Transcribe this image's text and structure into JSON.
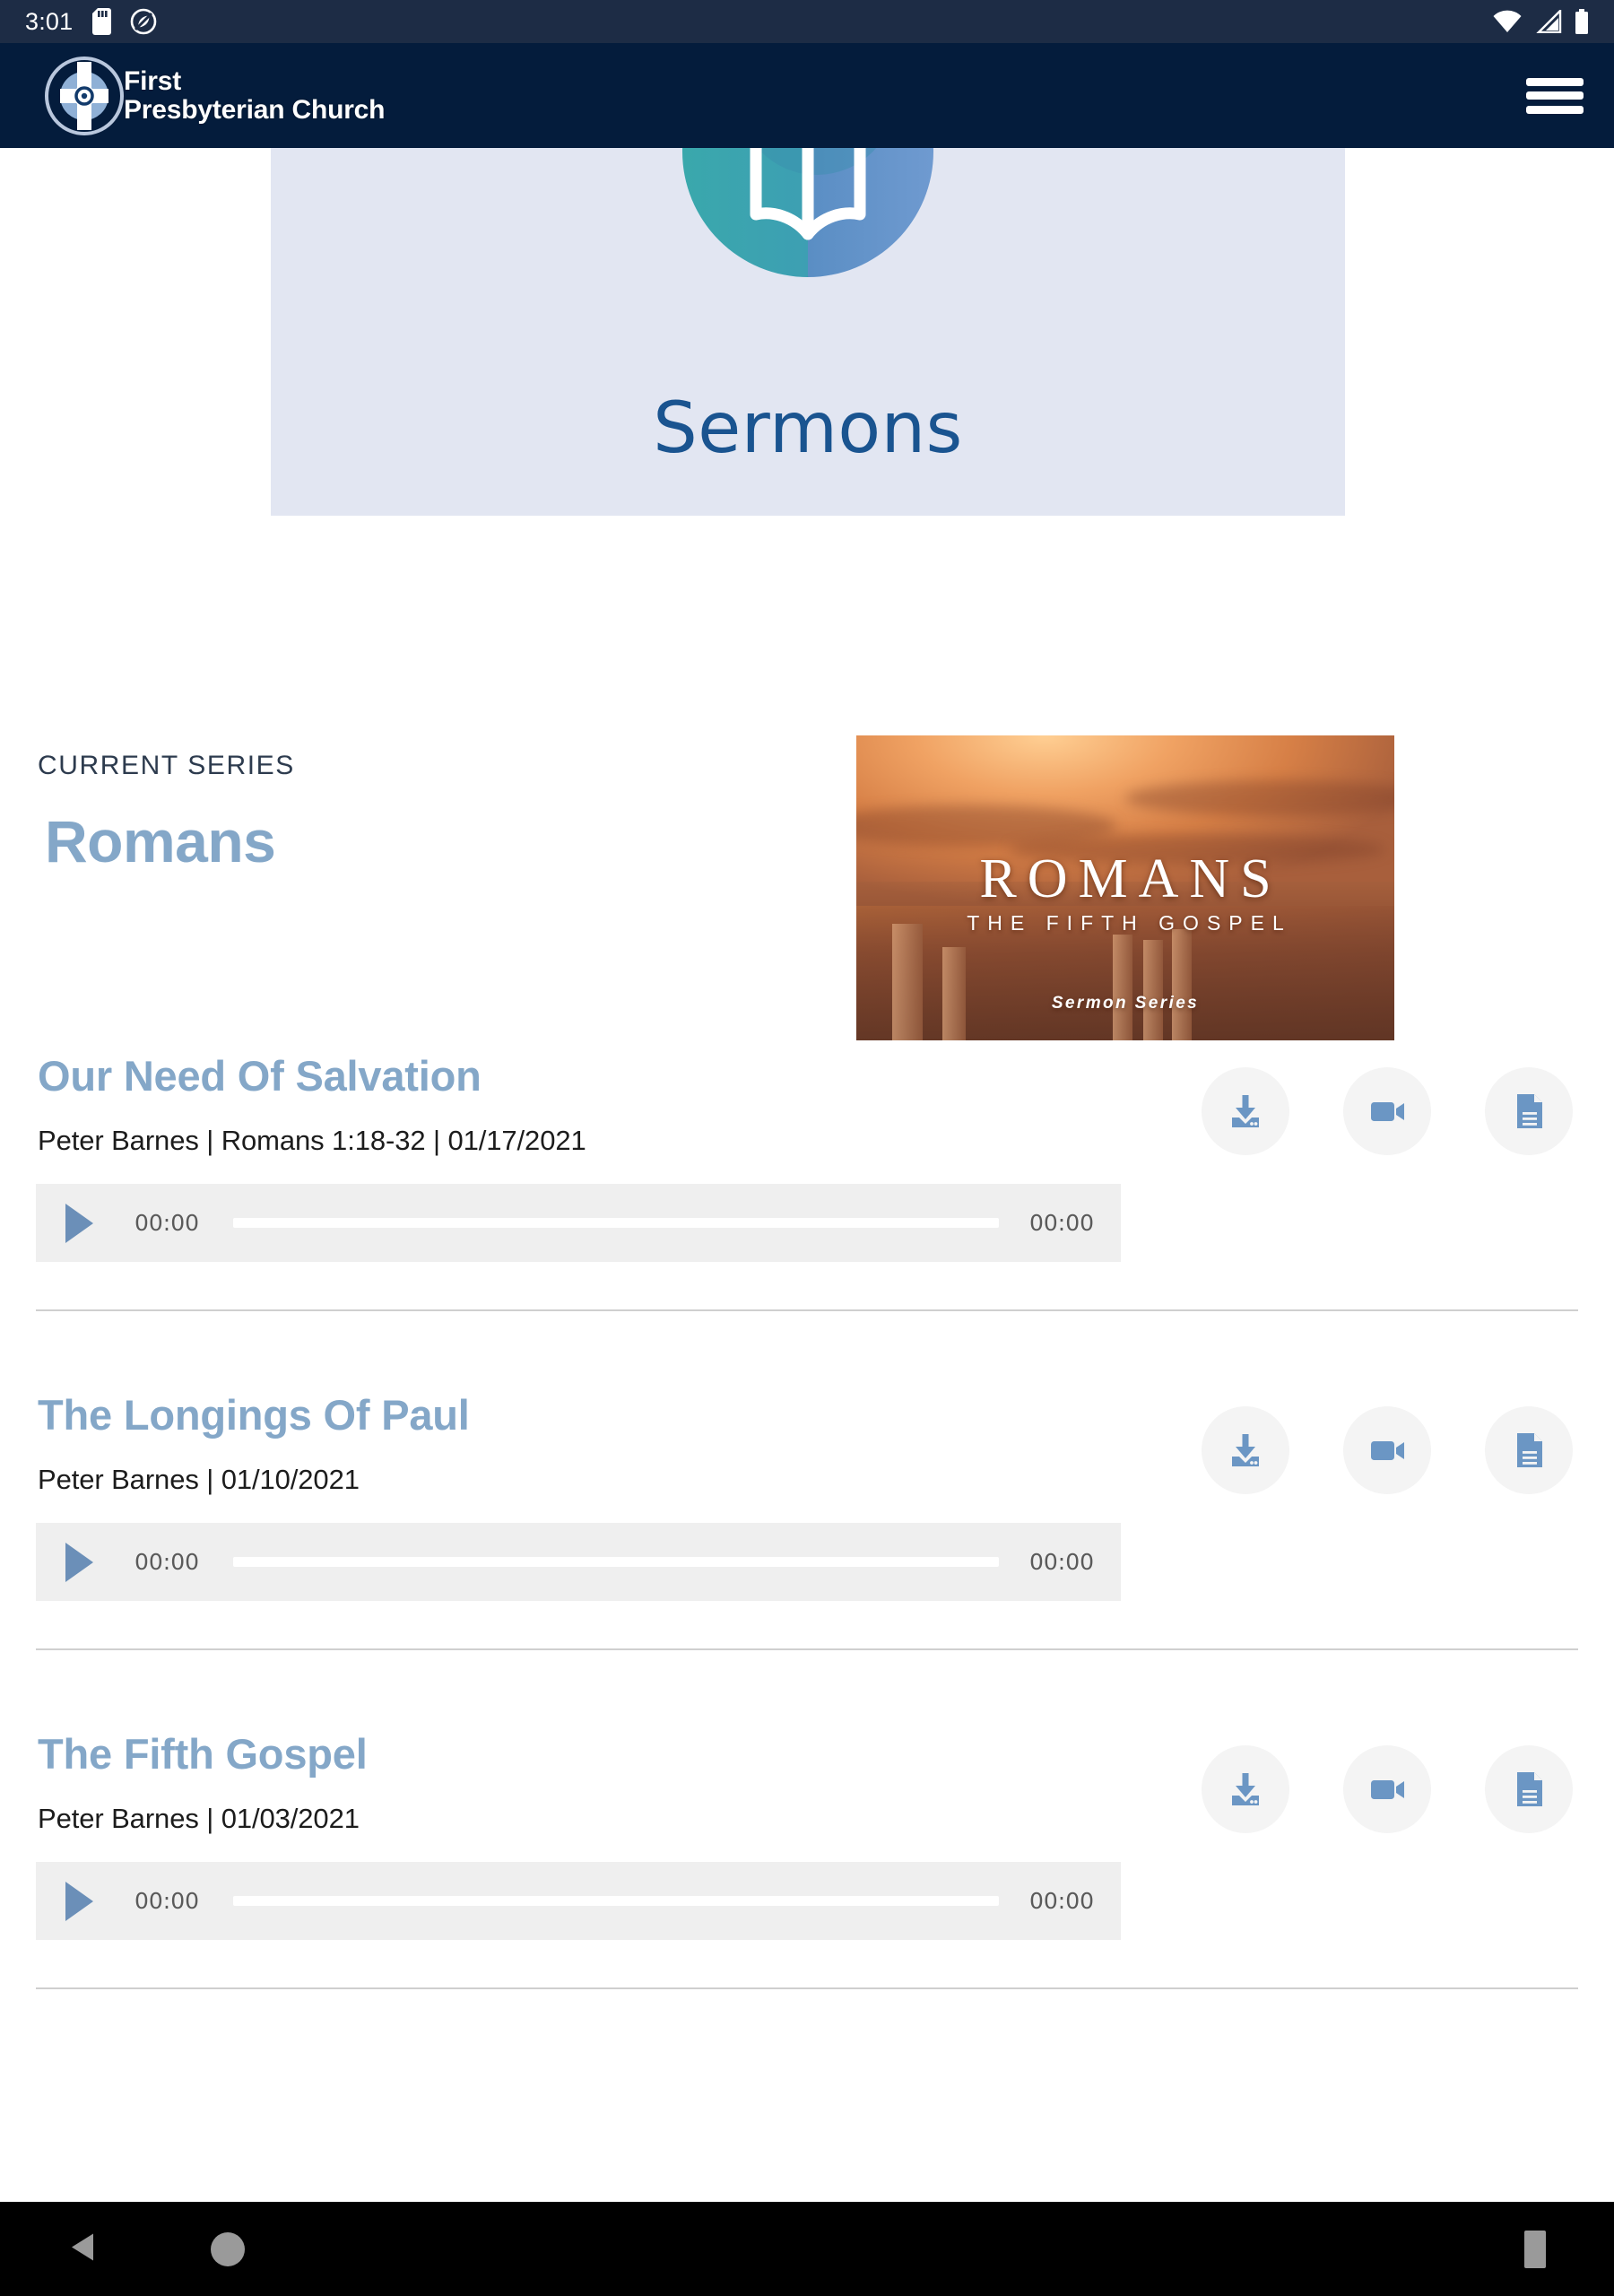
{
  "status_bar": {
    "clock": "3:01",
    "icons": [
      "sd-card-icon",
      "do-not-disturb-icon",
      "wifi-icon",
      "cellular-signal-icon",
      "battery-icon"
    ]
  },
  "header": {
    "brand_line1": "First",
    "brand_line2": "Presbyterian Church",
    "logo_name": "celtic-cross-logo",
    "menu_label": "hamburger-menu-icon"
  },
  "banner": {
    "title": "Sermons",
    "icon_name": "open-book-icon",
    "background": "#e2e6f2",
    "title_color": "#1a5490"
  },
  "current_series": {
    "label": "CURRENT SERIES",
    "title": "Romans",
    "title_color": "#84a7c8",
    "artwork": {
      "title": "ROMANS",
      "subtitle": "THE FIFTH GOSPEL",
      "tag": "Sermon Series"
    }
  },
  "sermons": [
    {
      "title": "Our Need Of Salvation",
      "meta": "Peter Barnes | Romans 1:18-32 | 01/17/2021",
      "player": {
        "current_time": "00:00",
        "total_time": "00:00",
        "progress": 0
      },
      "actions": [
        "download-icon",
        "video-camera-icon",
        "document-icon"
      ]
    },
    {
      "title": "The Longings Of Paul",
      "meta": "Peter Barnes | 01/10/2021",
      "player": {
        "current_time": "00:00",
        "total_time": "00:00",
        "progress": 0
      },
      "actions": [
        "download-icon",
        "video-camera-icon",
        "document-icon"
      ]
    },
    {
      "title": "The Fifth Gospel",
      "meta": "Peter Barnes | 01/03/2021",
      "player": {
        "current_time": "00:00",
        "total_time": "00:00",
        "progress": 0
      },
      "actions": [
        "download-icon",
        "video-camera-icon",
        "document-icon"
      ]
    }
  ],
  "navbar": {
    "back_label": "back-button",
    "home_label": "home-button",
    "recents_label": "recents-button"
  }
}
